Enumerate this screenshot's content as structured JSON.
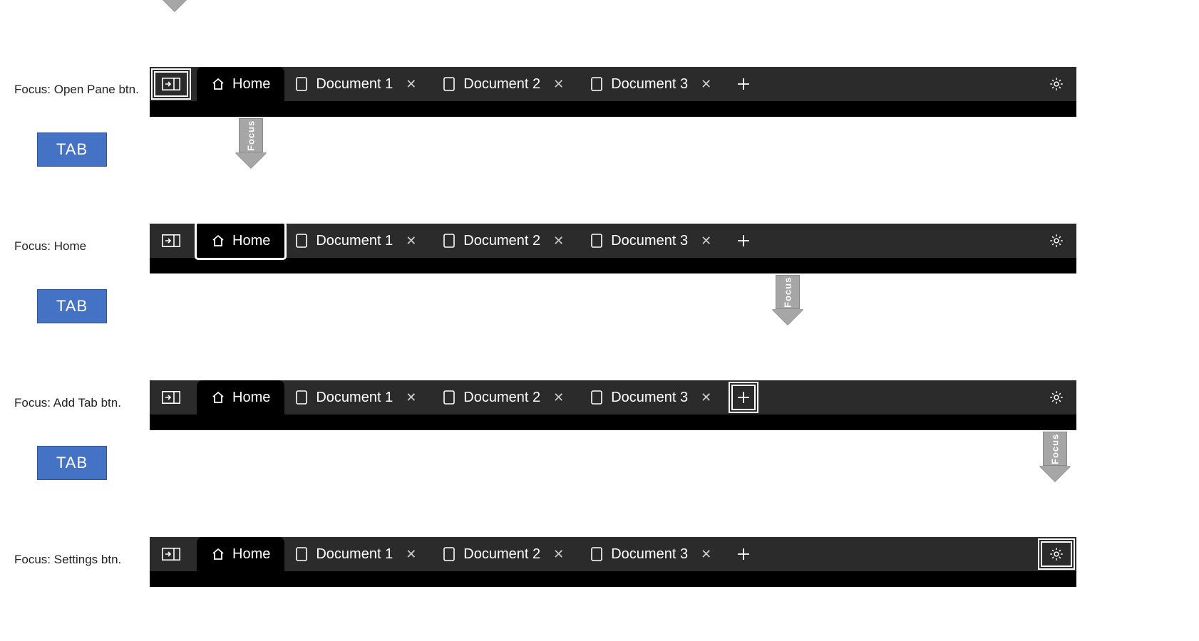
{
  "arrow_label": "Focus",
  "tab_key_label": "TAB",
  "captions": {
    "r1": "Focus: Open Pane btn.",
    "r2": "Focus: Home",
    "r3": "Focus: Add Tab btn.",
    "r4": "Focus: Settings btn."
  },
  "tabs": {
    "home": "Home",
    "doc1": "Document 1",
    "doc2": "Document 2",
    "doc3": "Document 3"
  },
  "icons": {
    "pane": "open-pane-icon",
    "home": "home-icon",
    "doc": "document-icon",
    "close": "close-icon",
    "add": "add-icon",
    "settings": "gear-icon"
  }
}
